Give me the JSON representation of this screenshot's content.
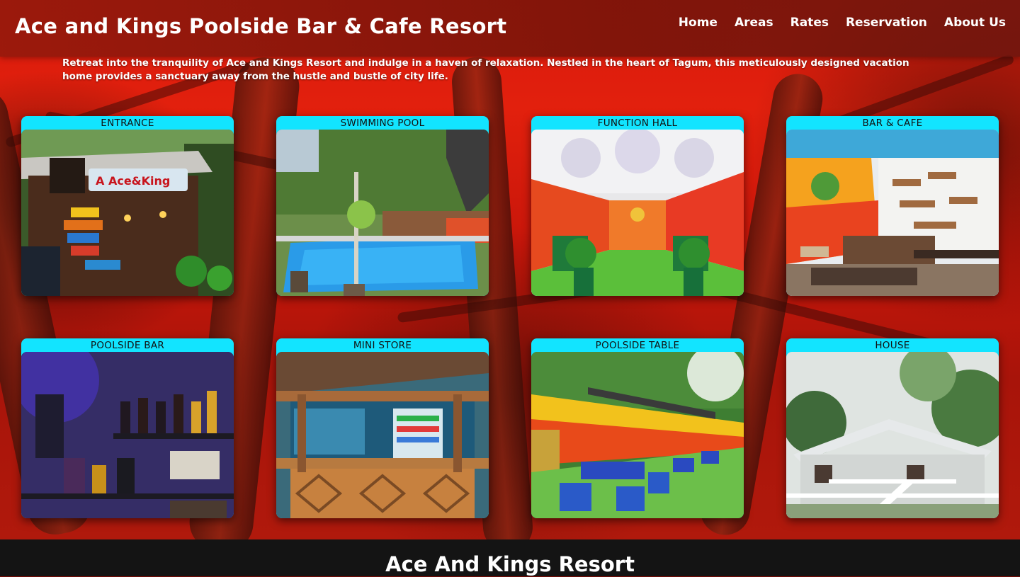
{
  "header": {
    "title": "Ace and Kings Poolside Bar & Cafe Resort",
    "nav": [
      "Home",
      "Areas",
      "Rates",
      "Reservation",
      "About Us"
    ]
  },
  "intro": "Retreat into the tranquility of Ace and Kings Resort and indulge in a haven of relaxation. Nestled in the heart of Tagum, this meticulously designed vacation home provides a sanctuary away from the hustle and bustle of city life.",
  "areas": [
    {
      "title": "ENTRANCE",
      "photo": "resort-entrance-photo"
    },
    {
      "title": "SWIMMING POOL",
      "photo": "swimming-pool-photo"
    },
    {
      "title": "FUNCTION HALL",
      "photo": "function-hall-photo"
    },
    {
      "title": "BAR & CAFE",
      "photo": "bar-cafe-photo"
    },
    {
      "title": "POOLSIDE BAR",
      "photo": "poolside-bar-photo"
    },
    {
      "title": "MINI STORE",
      "photo": "mini-store-photo"
    },
    {
      "title": "POOLSIDE TABLE",
      "photo": "poolside-table-photo"
    },
    {
      "title": "HOUSE",
      "photo": "house-photo"
    }
  ],
  "footer": {
    "title": "Ace And Kings Resort"
  },
  "colors": {
    "header": "#96190c",
    "card_title_bar": "#12e4ff",
    "footer": "#141414",
    "background": "#d81a0c"
  }
}
